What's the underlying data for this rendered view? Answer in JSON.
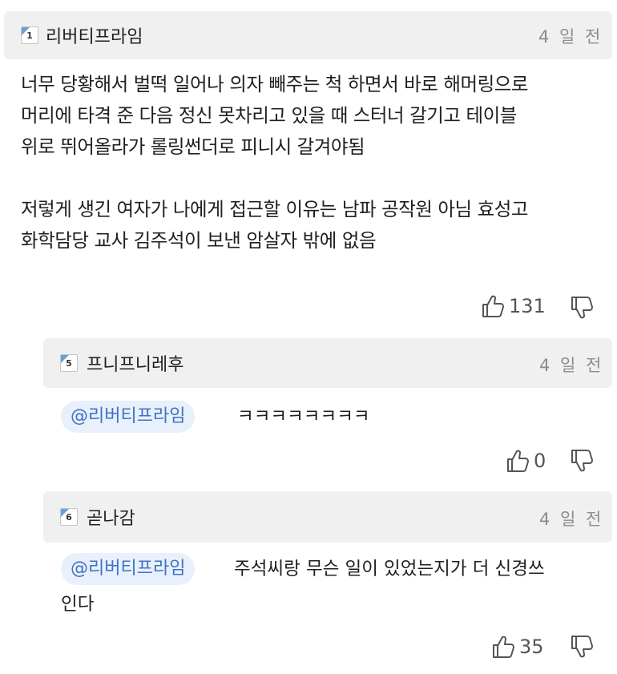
{
  "main_comment": {
    "level": "1",
    "author": "리버티프라임",
    "time": "4 일 전",
    "lines": [
      "너무 당황해서 벌떡 일어나 의자 빼주는 척 하면서 바로 해머링으로",
      "머리에 타격 준 다음 정신 못차리고 있을 때 스터너 갈기고 테이블",
      "위로 뛰어올라가 롤링썬더로 피니시 갈겨야됨",
      "",
      "저렇게 생긴 여자가 나에게 접근할 이유는 남파 공작원 아님 효성고",
      "화학담당 교사 김주석이 보낸 암살자 밖에 없음"
    ],
    "likes": "131"
  },
  "replies": [
    {
      "level": "5",
      "author": "프니프니레후",
      "time": "4 일 전",
      "mention": "@리버티프라임",
      "text": "ㅋㅋㅋㅋㅋㅋㅋㅋ",
      "likes": "0"
    },
    {
      "level": "6",
      "author": "곧나감",
      "time": "4 일 전",
      "mention": "@리버티프라임",
      "text_line1": "주석씨랑 무슨 일이 있었는지가 더 신경쓰",
      "text_line2": "인다",
      "likes": "35"
    }
  ],
  "icons": {
    "like": "thumbs-up-icon",
    "dislike": "thumbs-down-icon",
    "level": "level-badge-icon"
  },
  "colors": {
    "header_bg": "#f0f0f0",
    "mention_bg": "#e8f0fb",
    "mention_text": "#3e72c2",
    "time_text": "#8c8c8c"
  }
}
